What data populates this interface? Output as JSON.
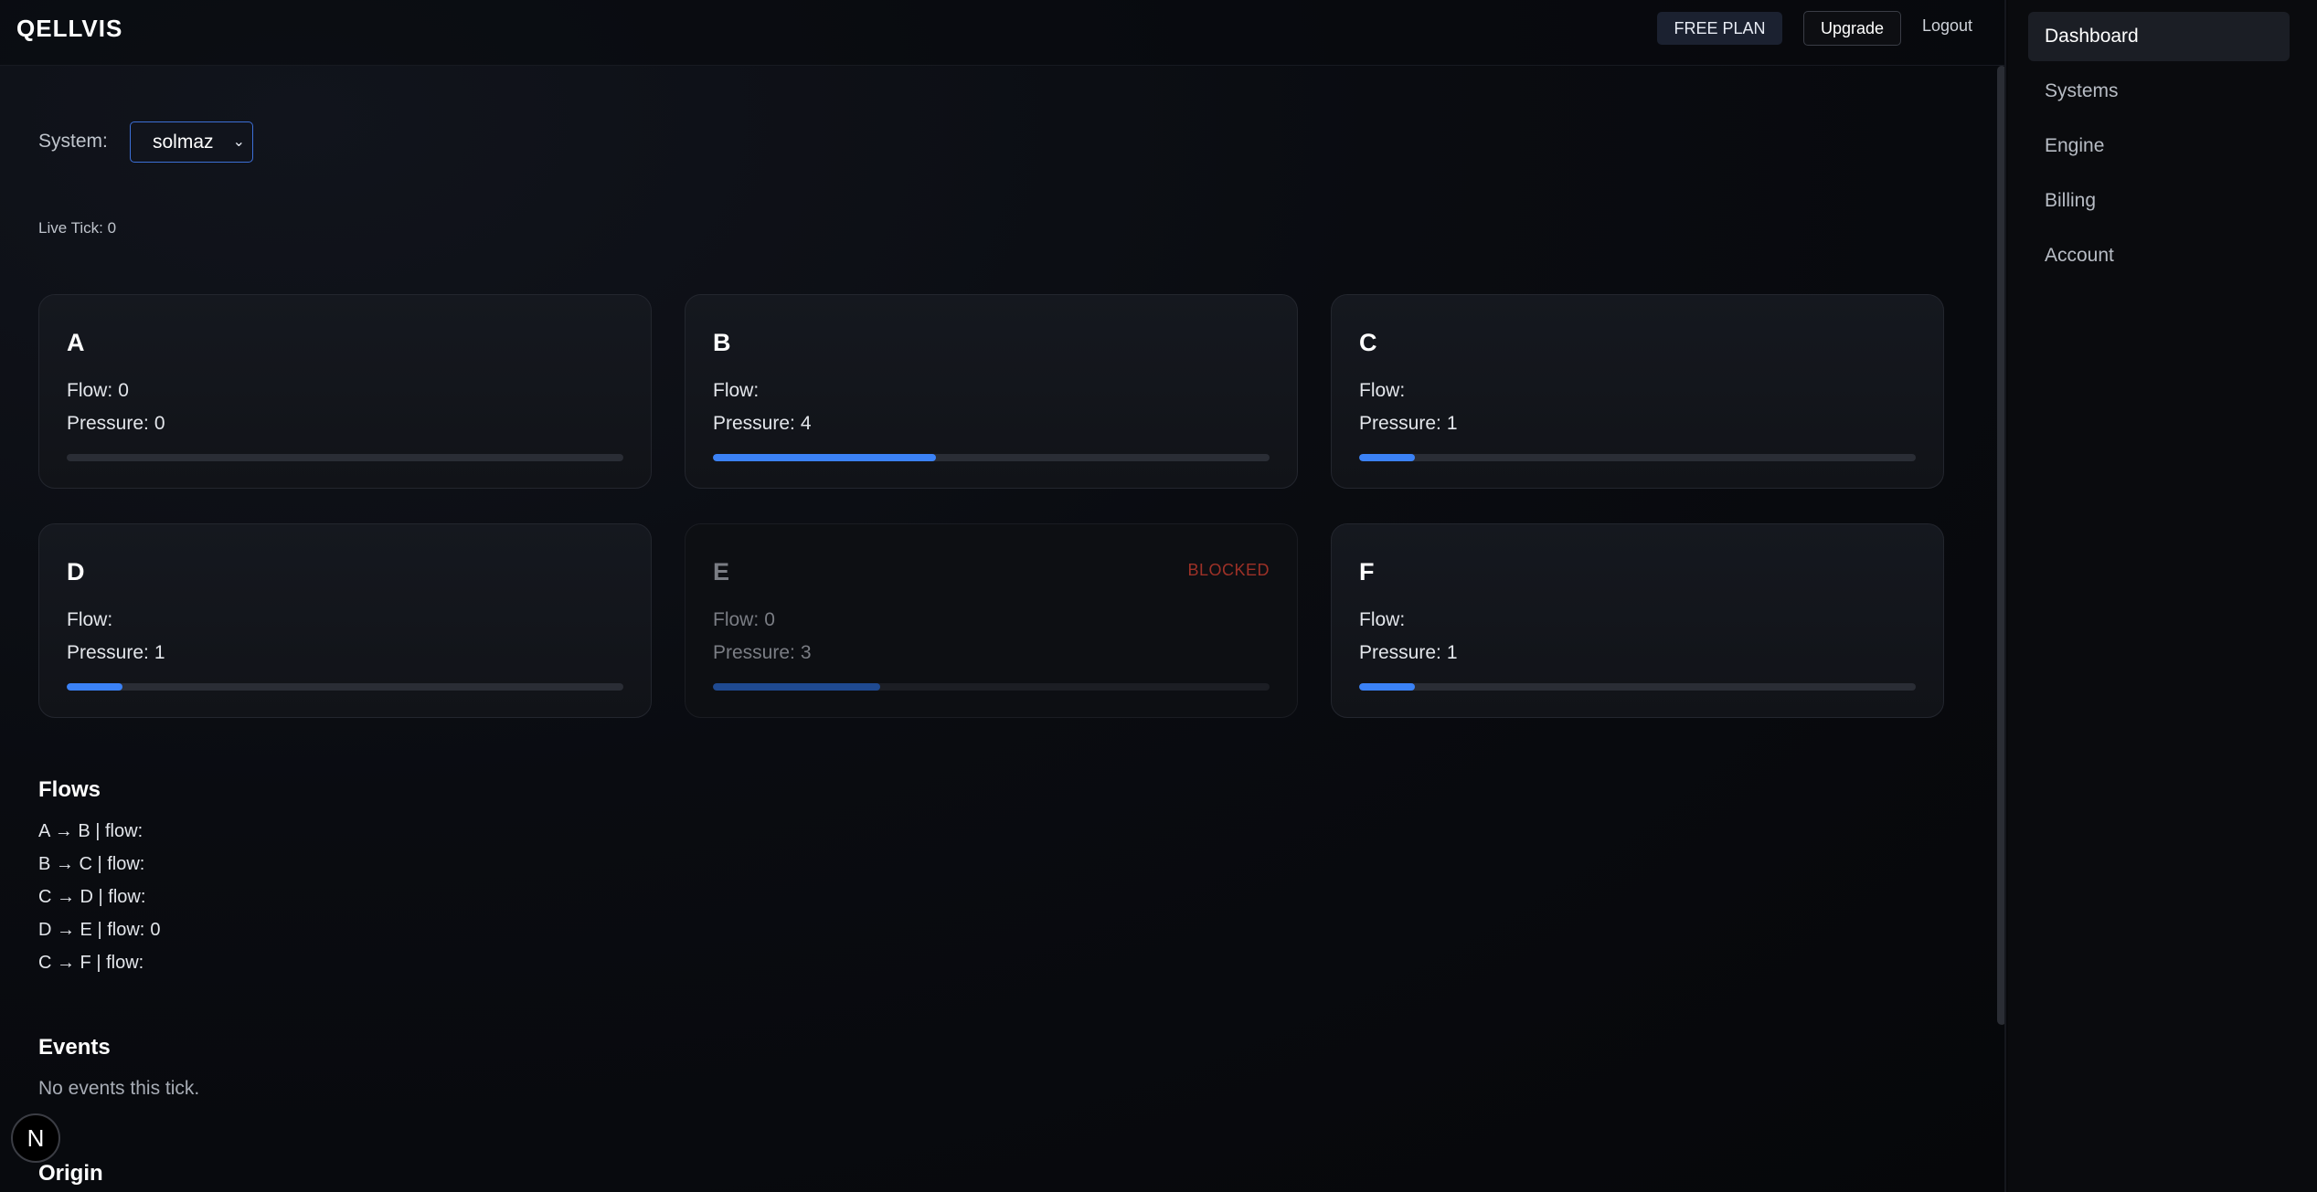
{
  "header": {
    "brand": "QELLVIS",
    "plan_badge": "FREE PLAN",
    "upgrade_label": "Upgrade",
    "logout_label": "Logout"
  },
  "system_selector": {
    "label": "System:",
    "selected": "solmaz"
  },
  "live_tick": "Live Tick: 0",
  "nodes": [
    {
      "name": "A",
      "flow_label": "Flow:",
      "flow": "0",
      "pressure_label": "Pressure:",
      "pressure": "0",
      "level": 0,
      "status": ""
    },
    {
      "name": "B",
      "flow_label": "Flow:",
      "flow": "",
      "pressure_label": "Pressure:",
      "pressure": "4",
      "level": 0.4,
      "status": ""
    },
    {
      "name": "C",
      "flow_label": "Flow:",
      "flow": "",
      "pressure_label": "Pressure:",
      "pressure": "1",
      "level": 0.1,
      "status": ""
    },
    {
      "name": "D",
      "flow_label": "Flow:",
      "flow": "",
      "pressure_label": "Pressure:",
      "pressure": "1",
      "level": 0.1,
      "status": ""
    },
    {
      "name": "E",
      "flow_label": "Flow:",
      "flow": "0",
      "pressure_label": "Pressure:",
      "pressure": "3",
      "level": 0.3,
      "status": "BLOCKED"
    },
    {
      "name": "F",
      "flow_label": "Flow:",
      "flow": "",
      "pressure_label": "Pressure:",
      "pressure": "1",
      "level": 0.1,
      "status": ""
    }
  ],
  "flows": {
    "title": "Flows",
    "items": [
      {
        "label": "A → B | flow:",
        "value": ""
      },
      {
        "label": "B → C | flow:",
        "value": ""
      },
      {
        "label": "C → D | flow:",
        "value": ""
      },
      {
        "label": "D → E | flow:",
        "value": "0"
      },
      {
        "label": "C → F | flow:",
        "value": ""
      }
    ]
  },
  "events": {
    "title": "Events",
    "empty_text": "No events this tick."
  },
  "origin": {
    "title": "Origin"
  },
  "floating_badge": "N",
  "sidebar": {
    "items": [
      {
        "label": "Dashboard",
        "active": true
      },
      {
        "label": "Systems",
        "active": false
      },
      {
        "label": "Engine",
        "active": false
      },
      {
        "label": "Billing",
        "active": false
      },
      {
        "label": "Account",
        "active": false
      }
    ]
  },
  "colors": {
    "accent": "#3b82f6",
    "blocked": "#c0392b",
    "background": "#07080b"
  }
}
